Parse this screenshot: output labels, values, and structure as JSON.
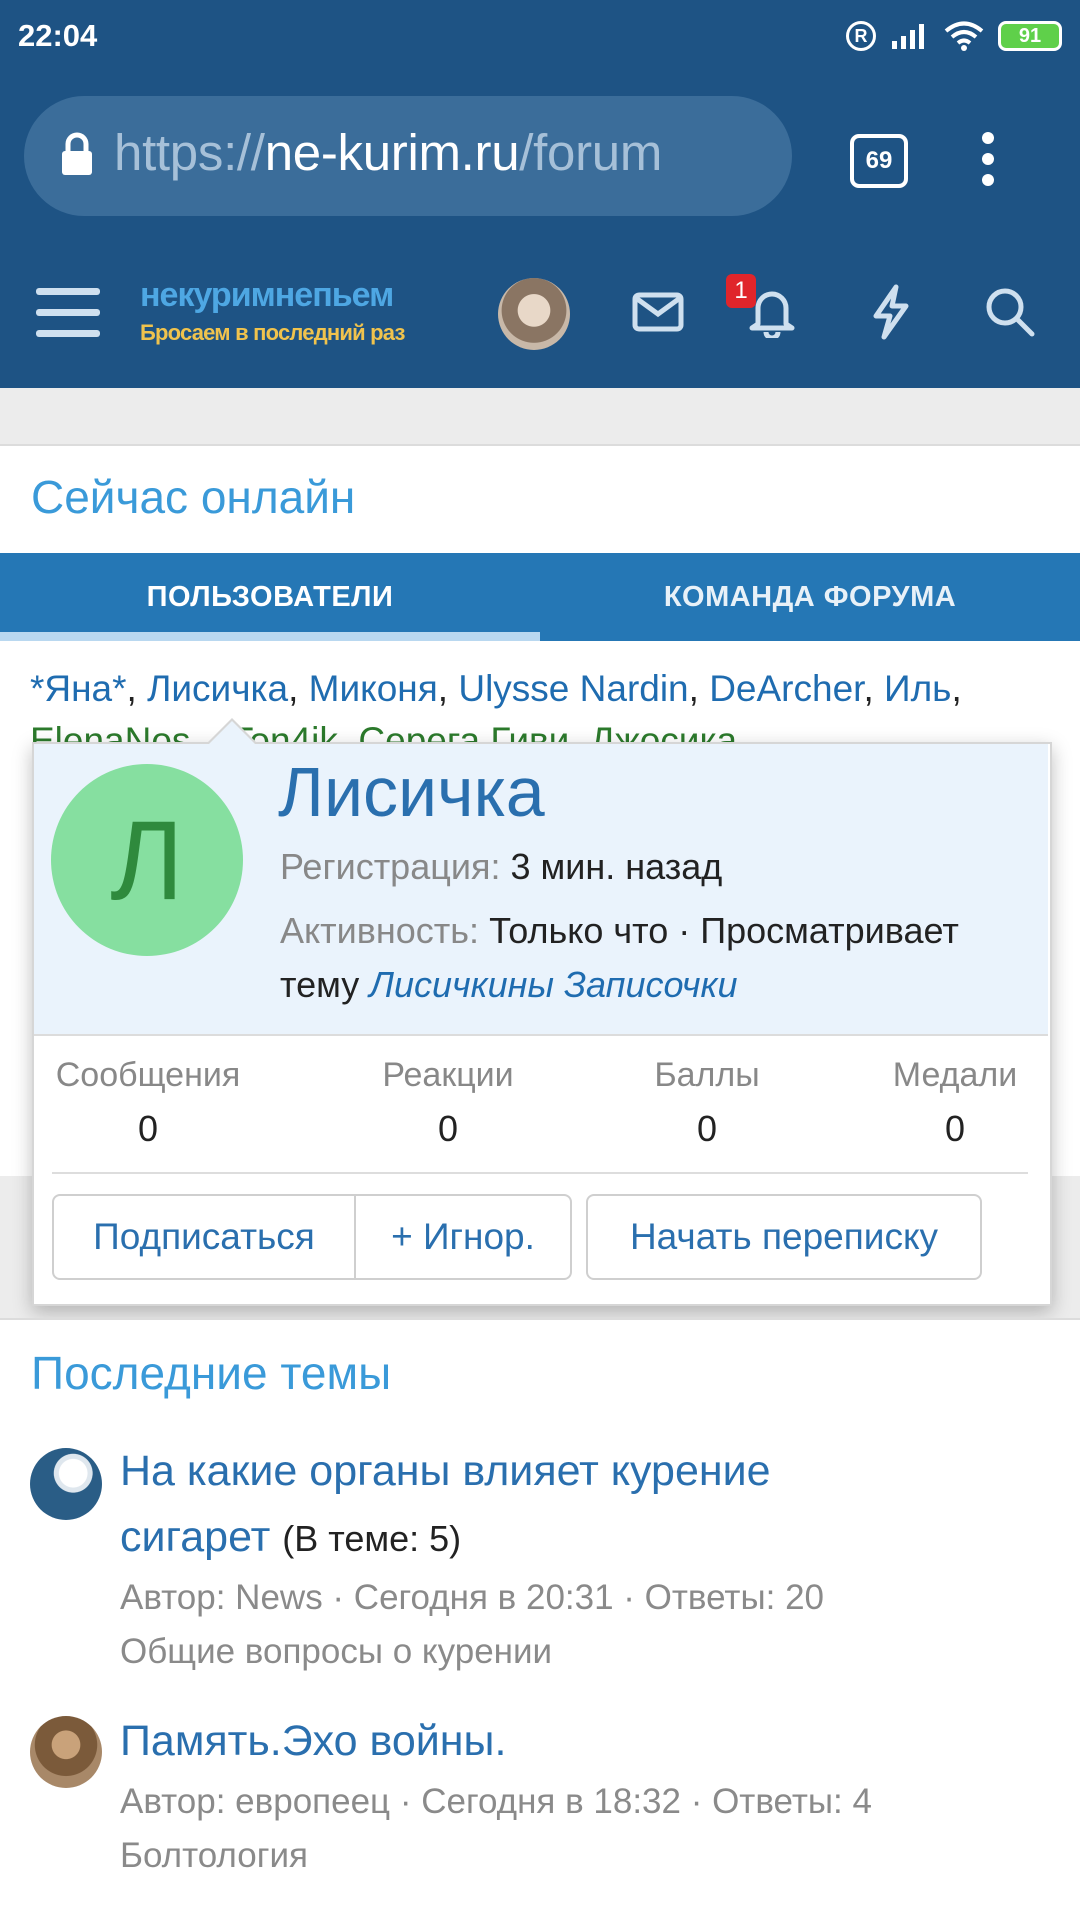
{
  "status": {
    "time": "22:04",
    "battery": "91"
  },
  "browser": {
    "url_scheme": "https://",
    "url_host": "ne-kurim.ru",
    "url_path": "/forum",
    "tab_count": "69"
  },
  "header": {
    "logo_main": "некуримнепьем",
    "logo_tagline": "Бросаем в последний раз",
    "notif_count": "1"
  },
  "online": {
    "title": "Сейчас онлайн",
    "tabs": [
      {
        "label": "ПОЛЬЗОВАТЕЛИ"
      },
      {
        "label": "КОМАНДА ФОРУМА"
      }
    ],
    "users": [
      "*Яна*",
      "Лисичка",
      "Миконя",
      "Ulysse Nardin",
      "DeArcher",
      "Иль"
    ],
    "users_row2": "ElenaNos... Ton4ik, Серега Гиви, Джосика"
  },
  "popup": {
    "initial": "Л",
    "name": "Лисичка",
    "reg_label": "Регистрация:",
    "reg_value": "3 мин. назад",
    "act_label": "Активность:",
    "act_value": "Только что · Просматривает",
    "act_line2": "тему",
    "act_topic": "Лисичкины Записочки",
    "stats": [
      {
        "label": "Сообщения",
        "value": "0"
      },
      {
        "label": "Реакции",
        "value": "0"
      },
      {
        "label": "Баллы",
        "value": "0"
      },
      {
        "label": "Медали",
        "value": "0"
      }
    ],
    "buttons": {
      "follow": "Подписаться",
      "ignore": "+ Игнор.",
      "message": "Начать переписку"
    }
  },
  "latest": {
    "title": "Последние темы",
    "threads": [
      {
        "title_line1": "На какие органы влияет курение",
        "title_line2": "сигарет",
        "count": "(В теме: 5)",
        "meta": "Автор: News · Сегодня в 20:31 · Ответы: 20",
        "forum": "Общие вопросы о курении"
      },
      {
        "title_line1": "Память.Эхо войны.",
        "meta": "Автор: европеец · Сегодня в 18:32 · Ответы: 4",
        "forum": "Болтология"
      }
    ]
  }
}
